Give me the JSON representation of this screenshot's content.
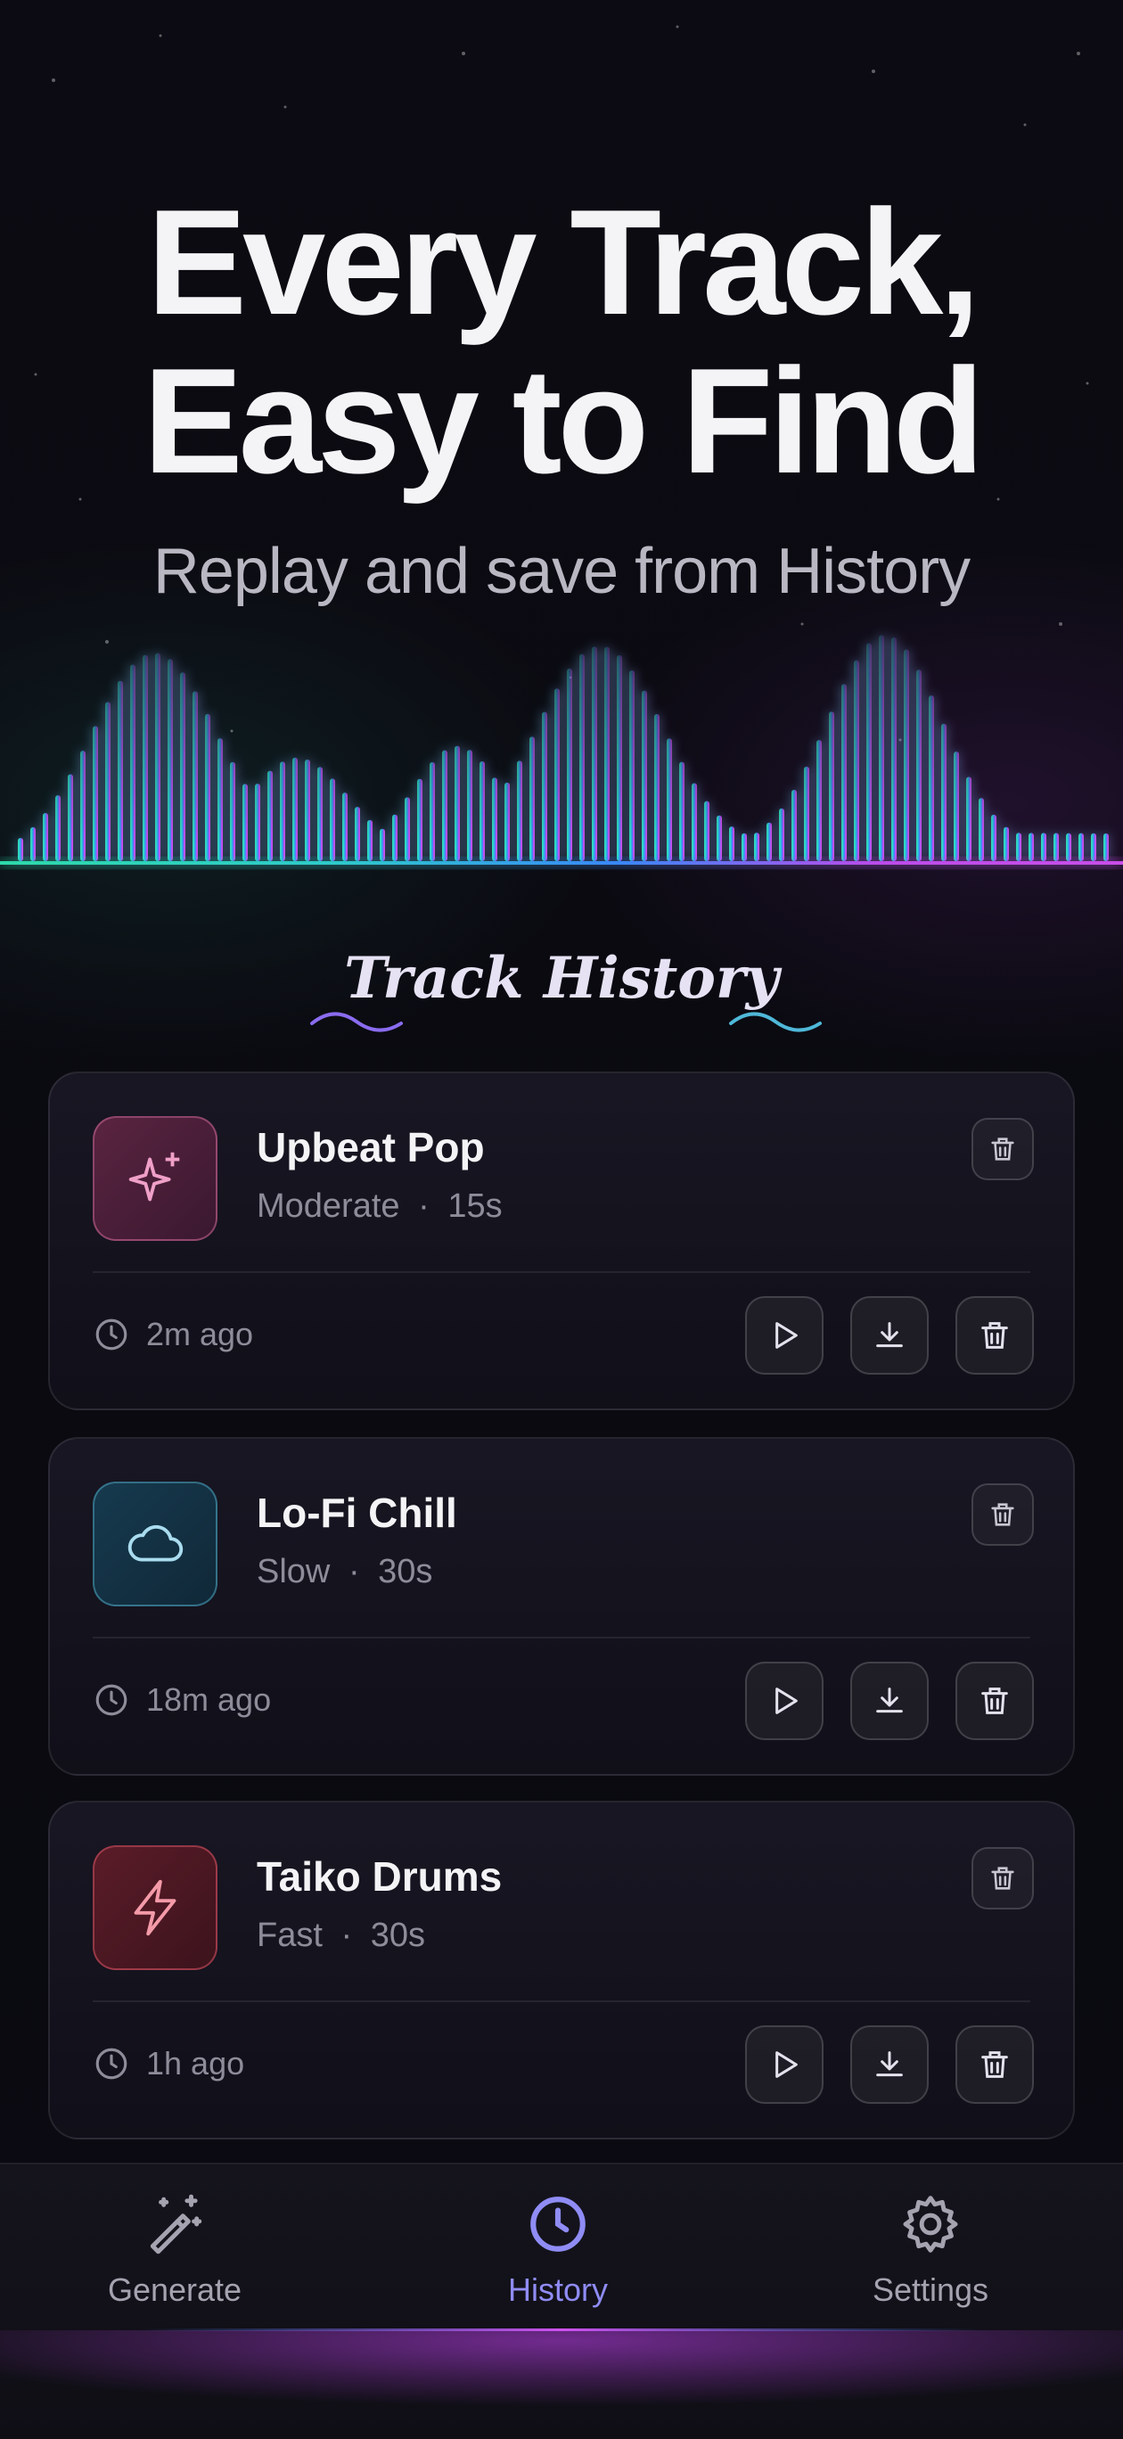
{
  "hero": {
    "headline_line1": "Every Track,",
    "headline_line2": "Easy to Find",
    "subheadline": "Replay and save from History"
  },
  "section": {
    "title": "Track History"
  },
  "tracks": [
    {
      "title": "Upbeat Pop",
      "tempo": "Moderate",
      "duration": "15s",
      "time_ago": "2m ago",
      "icon": "sparkle-icon",
      "color": "#e57aa8"
    },
    {
      "title": "Lo-Fi Chill",
      "tempo": "Slow",
      "duration": "30s",
      "time_ago": "18m ago",
      "icon": "cloud-icon",
      "color": "#7fc6e0"
    },
    {
      "title": "Taiko Drums",
      "tempo": "Fast",
      "duration": "30s",
      "time_ago": "1h ago",
      "icon": "lightning-icon",
      "color": "#ef6b80"
    }
  ],
  "meta_separator": "·",
  "nav": {
    "items": [
      {
        "label": "Generate",
        "icon": "magic-wand-icon",
        "active": false
      },
      {
        "label": "History",
        "icon": "clock-icon",
        "active": true
      },
      {
        "label": "Settings",
        "icon": "gear-icon",
        "active": false
      }
    ]
  },
  "colors": {
    "background": "#0b0a12",
    "accent_active": "#8f8cf5",
    "wave_teal": "#2fe0b0",
    "wave_blue": "#3b8cff",
    "wave_magenta": "#d050f0"
  }
}
